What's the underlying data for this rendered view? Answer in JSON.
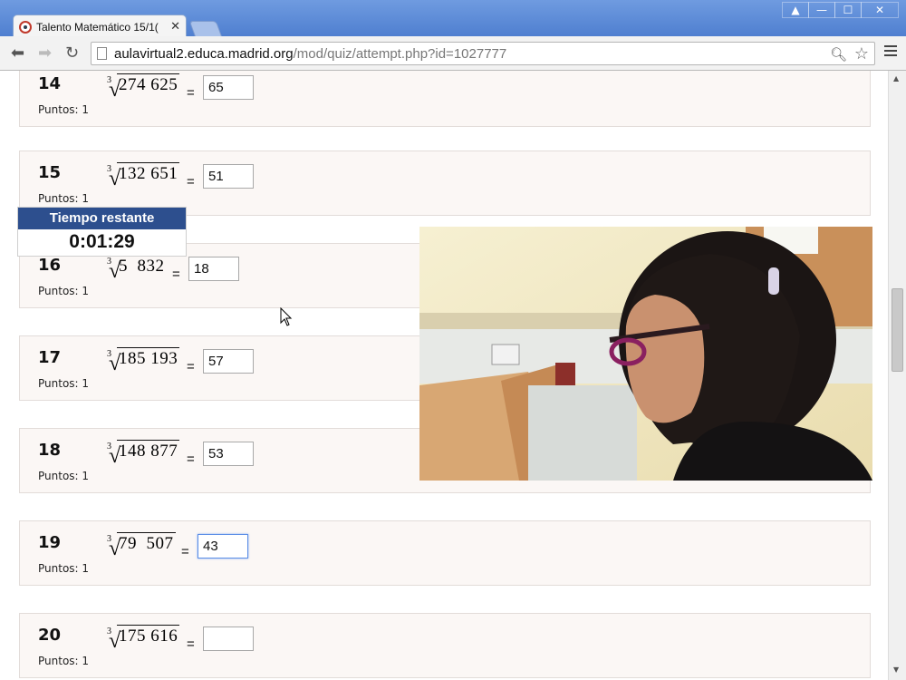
{
  "browser": {
    "tab_title": "Talento Matemático 15/1(",
    "tab_close": "✕",
    "url_host": "aulavirtual2.educa.madrid.org",
    "url_path": "/mod/quiz/attempt.php?id=1027777",
    "window_buttons": [
      "▲",
      "—",
      "☐",
      "✕"
    ]
  },
  "timer": {
    "label": "Tiempo restante",
    "value": "0:01:29"
  },
  "questions": [
    {
      "number": "14",
      "points": "Puntos: 1",
      "index": "3",
      "radicand": "274 625",
      "equals": "=",
      "answer": "65"
    },
    {
      "number": "15",
      "points": "Puntos: 1",
      "index": "3",
      "radicand": "132 651",
      "equals": "=",
      "answer": "51"
    },
    {
      "number": "16",
      "points": "Puntos: 1",
      "index": "3",
      "radicand": "5  832",
      "equals": "=",
      "answer": "18"
    },
    {
      "number": "17",
      "points": "Puntos: 1",
      "index": "3",
      "radicand": "185 193",
      "equals": "=",
      "answer": "57"
    },
    {
      "number": "18",
      "points": "Puntos: 1",
      "index": "3",
      "radicand": "148 877",
      "equals": "=",
      "answer": "53"
    },
    {
      "number": "19",
      "points": "Puntos: 1",
      "index": "3",
      "radicand": "79  507",
      "equals": "=",
      "answer": "43"
    },
    {
      "number": "20",
      "points": "Puntos: 1",
      "index": "3",
      "radicand": "175 616",
      "equals": "=",
      "answer": ""
    }
  ],
  "colors": {
    "timer_header": "#2d4f8e",
    "question_bg": "#fbf7f5",
    "chrome_blue": "#5c8ad6"
  }
}
